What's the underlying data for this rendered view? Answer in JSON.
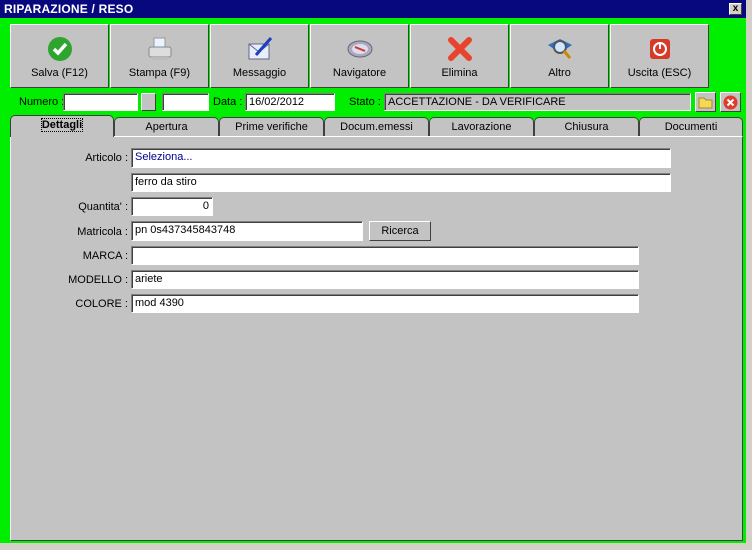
{
  "window": {
    "title": "RIPARAZIONE / RESO",
    "close": "x"
  },
  "toolbar": [
    {
      "label": "Salva (F12)",
      "icon": "check-icon"
    },
    {
      "label": "Stampa (F9)",
      "icon": "printer-icon"
    },
    {
      "label": "Messaggio",
      "icon": "envelope-pen-icon"
    },
    {
      "label": "Navigatore",
      "icon": "compass-icon"
    },
    {
      "label": "Elimina",
      "icon": "delete-x-icon"
    },
    {
      "label": "Altro",
      "icon": "search-book-icon"
    },
    {
      "label": "Uscita (ESC)",
      "icon": "power-icon"
    }
  ],
  "header": {
    "numero_label": "Numero :",
    "numero_value": "",
    "numero2_value": "",
    "data_label": "Data :",
    "data_value": "16/02/2012",
    "stato_label": "Stato :",
    "stato_value": "ACCETTAZIONE - DA VERIFICARE"
  },
  "tabs": [
    "Dettagli",
    "Apertura",
    "Prime verifiche",
    "Docum.emessi",
    "Lavorazione",
    "Chiusura",
    "Documenti"
  ],
  "form": {
    "articolo_label": "Articolo :",
    "articolo_value": "Seleziona...",
    "descrizione_value": "ferro da stiro",
    "quantita_label": "Quantita' :",
    "quantita_value": "0",
    "matricola_label": "Matricola :",
    "matricola_value": "pn 0s437345843748",
    "ricerca_label": "Ricerca",
    "marca_label": "MARCA :",
    "marca_value": "",
    "modello_label": "MODELLO :",
    "modello_value": "ariete",
    "colore_label": "COLORE :",
    "colore_value": "mod 4390"
  }
}
